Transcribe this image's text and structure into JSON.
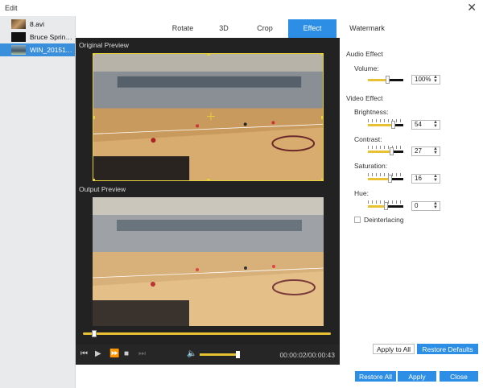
{
  "window": {
    "title": "Edit",
    "close_glyph": "✕"
  },
  "files": [
    {
      "name": "8.avi",
      "thumb": "thumb-video"
    },
    {
      "name": "Bruce Springs...",
      "thumb": "thumb-black"
    },
    {
      "name": "WIN_2015112...",
      "thumb": "thumb-court",
      "selected": true
    }
  ],
  "tabs": [
    {
      "label": "Rotate"
    },
    {
      "label": "3D"
    },
    {
      "label": "Crop"
    },
    {
      "label": "Effect",
      "active": true
    },
    {
      "label": "Watermark"
    }
  ],
  "preview": {
    "original_label": "Original Preview",
    "output_label": "Output Preview",
    "time": "00:00:02/00:00:43",
    "progress": 0.035,
    "volume": 0.9
  },
  "audio": {
    "section_title": "Audio Effect",
    "volume_label": "Volume:",
    "volume_value": "100%",
    "volume_level": 0.55
  },
  "video": {
    "section_title": "Video Effect",
    "brightness_label": "Brightness:",
    "brightness_value": "54",
    "brightness_level": 0.7,
    "contrast_label": "Contrast:",
    "contrast_value": "27",
    "contrast_level": 0.65,
    "saturation_label": "Saturation:",
    "saturation_value": "16",
    "saturation_level": 0.62,
    "hue_label": "Hue:",
    "hue_value": "0",
    "hue_level": 0.5,
    "deinterlacing_label": "Deinterlacing",
    "deinterlacing_checked": false
  },
  "buttons": {
    "apply_to_all": "Apply to All",
    "restore_defaults": "Restore Defaults",
    "restore_all": "Restore All",
    "apply": "Apply",
    "close": "Close"
  },
  "colors": {
    "accent": "#2d8ee6",
    "slider_fill": "#e8c233",
    "crop_border": "#e5d13a"
  },
  "icons": [
    "close-icon",
    "skip-back-icon",
    "play-icon",
    "fast-forward-icon",
    "stop-icon",
    "skip-end-icon",
    "volume-icon",
    "spin-arrows-icon"
  ]
}
